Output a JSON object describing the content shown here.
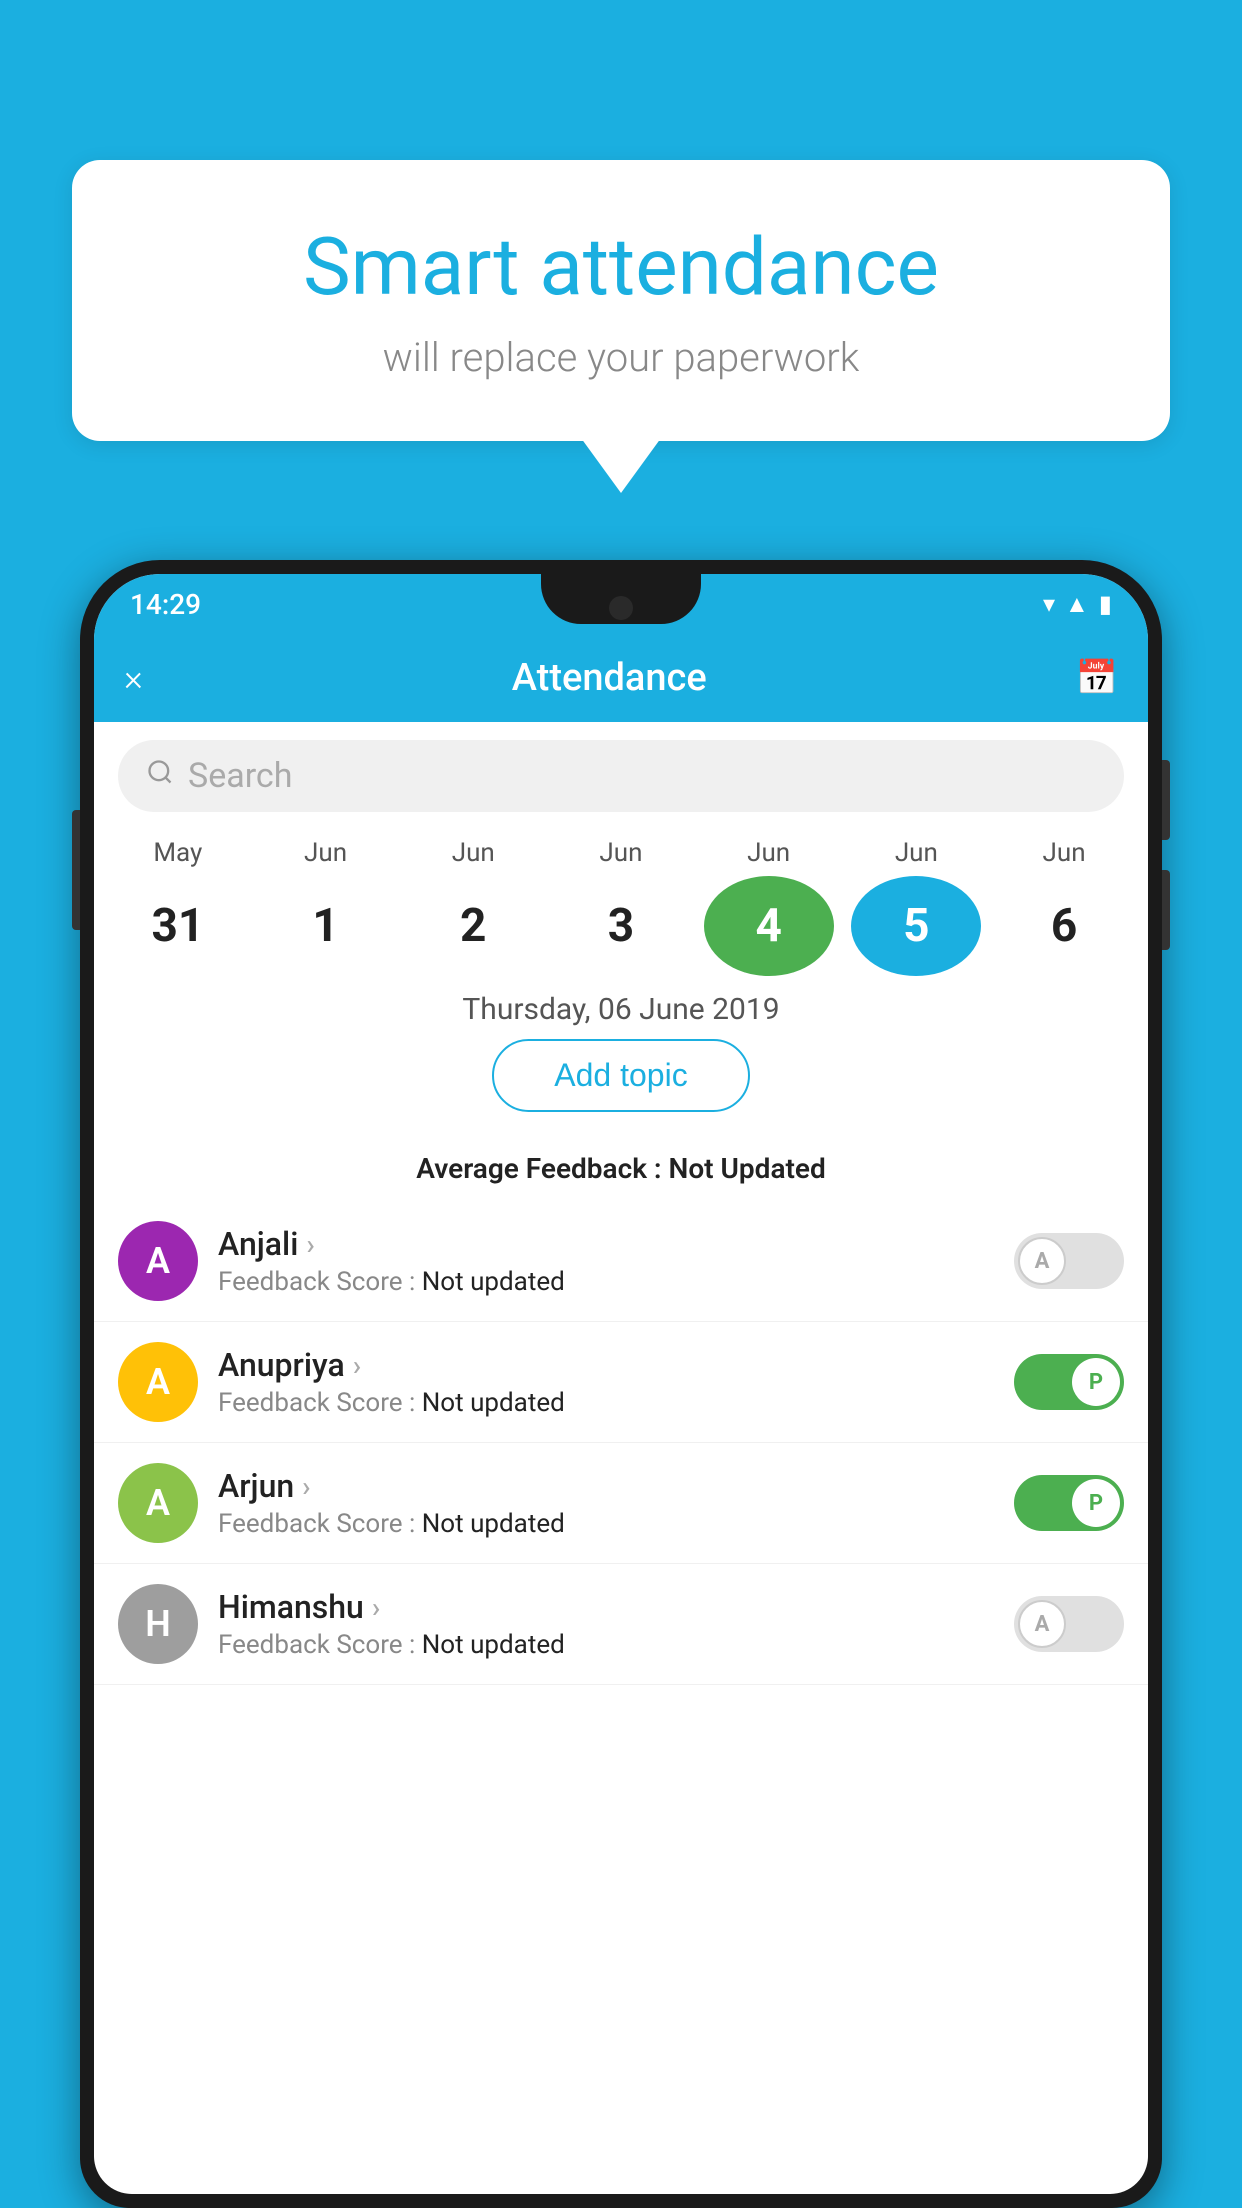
{
  "background": {
    "color": "#1BAFE0"
  },
  "bubble": {
    "title": "Smart attendance",
    "subtitle": "will replace your paperwork"
  },
  "statusBar": {
    "time": "14:29",
    "icons": [
      "wifi",
      "signal",
      "battery"
    ]
  },
  "appBar": {
    "close_label": "×",
    "title": "Attendance",
    "calendar_icon": "📅"
  },
  "search": {
    "placeholder": "Search"
  },
  "calendar": {
    "months": [
      "May",
      "Jun",
      "Jun",
      "Jun",
      "Jun",
      "Jun",
      "Jun"
    ],
    "days": [
      "31",
      "1",
      "2",
      "3",
      "4",
      "5",
      "6"
    ],
    "today_index": 4,
    "selected_index": 5,
    "selected_date_label": "Thursday, 06 June 2019"
  },
  "addTopic": {
    "label": "Add topic"
  },
  "avgFeedback": {
    "label": "Average Feedback :",
    "value": "Not Updated"
  },
  "students": [
    {
      "name": "Anjali",
      "avatar_letter": "A",
      "avatar_color": "#9C27B0",
      "feedback_label": "Feedback Score :",
      "feedback_value": "Not updated",
      "status": "absent",
      "toggle_letter": "A"
    },
    {
      "name": "Anupriya",
      "avatar_letter": "A",
      "avatar_color": "#FFC107",
      "feedback_label": "Feedback Score :",
      "feedback_value": "Not updated",
      "status": "present",
      "toggle_letter": "P"
    },
    {
      "name": "Arjun",
      "avatar_letter": "A",
      "avatar_color": "#8BC34A",
      "feedback_label": "Feedback Score :",
      "feedback_value": "Not updated",
      "status": "present",
      "toggle_letter": "P"
    },
    {
      "name": "Himanshu",
      "avatar_letter": "H",
      "avatar_color": "#9E9E9E",
      "feedback_label": "Feedback Score :",
      "feedback_value": "Not updated",
      "status": "absent",
      "toggle_letter": "A"
    }
  ]
}
